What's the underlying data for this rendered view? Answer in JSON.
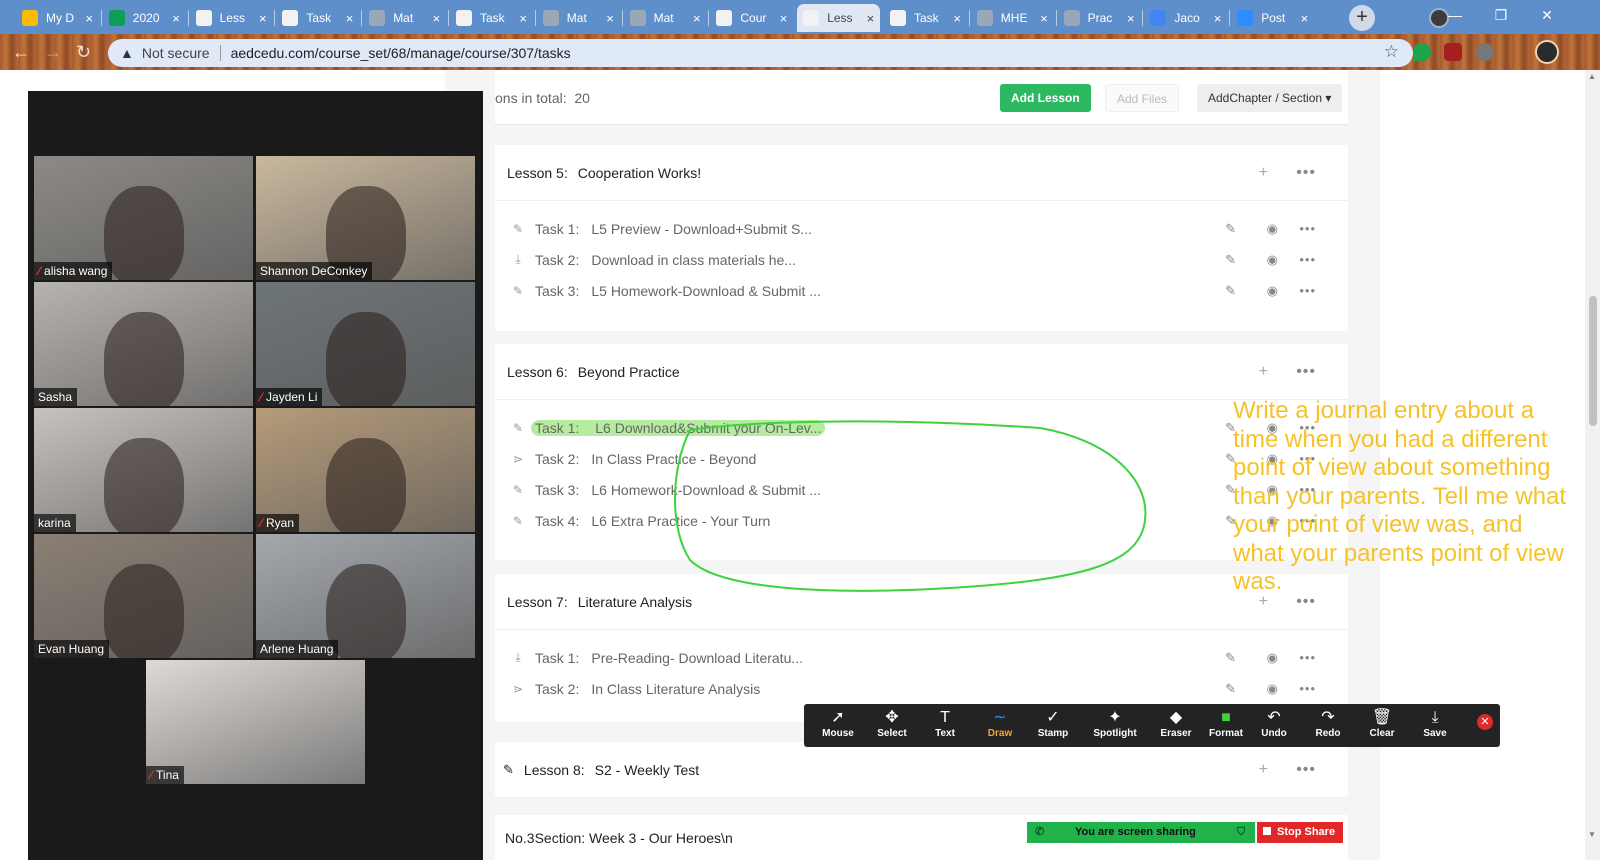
{
  "browser": {
    "tabs": [
      {
        "label": "My D",
        "favicon_color": "#fbbc05",
        "active": false
      },
      {
        "label": "2020",
        "favicon_color": "#0f9d58",
        "active": false
      },
      {
        "label": "Less",
        "favicon_color": "#f2f2f2",
        "active": false
      },
      {
        "label": "Task",
        "favicon_color": "#f2f2f2",
        "active": false
      },
      {
        "label": "Mat",
        "favicon_color": "#9aa7b8",
        "active": false
      },
      {
        "label": "Task",
        "favicon_color": "#f2f2f2",
        "active": false
      },
      {
        "label": "Mat",
        "favicon_color": "#9aa7b8",
        "active": false
      },
      {
        "label": "Mat",
        "favicon_color": "#9aa7b8",
        "active": false
      },
      {
        "label": "Cour",
        "favicon_color": "#f2f2f2",
        "active": false
      },
      {
        "label": "Less",
        "favicon_color": "#f2f2f2",
        "active": true
      },
      {
        "label": "Task",
        "favicon_color": "#f2f2f2",
        "active": false
      },
      {
        "label": "MHE",
        "favicon_color": "#9aa7b8",
        "active": false
      },
      {
        "label": "Prac",
        "favicon_color": "#9aa7b8",
        "active": false
      },
      {
        "label": "Jaco",
        "favicon_color": "#4285f4",
        "active": false
      },
      {
        "label": "Post",
        "favicon_color": "#2d8cff",
        "active": false
      }
    ],
    "tab_close": "×",
    "new_tab": "+",
    "address": {
      "security_label": "Not secure",
      "url": "aedcedu.com/course_set/68/manage/course/307/tasks"
    },
    "nav": {
      "back": "←",
      "forward": "→",
      "reload": "↻",
      "star": "☆"
    }
  },
  "page": {
    "lessons_total_label": "ons in total:",
    "lessons_total_value": "20",
    "buttons": {
      "add_lesson": "Add Lesson",
      "add_files": "Add Files",
      "add_chapter": "AddChapter / Section ▾"
    },
    "lessons": [
      {
        "num": "Lesson 5:",
        "title": "Cooperation Works!",
        "tasks": [
          {
            "icon": "✎",
            "num": "Task 1:",
            "title": "L5 Preview - Download+Submit S..."
          },
          {
            "icon": "⤓",
            "num": "Task 2:",
            "title": "Download in class materials he..."
          },
          {
            "icon": "✎",
            "num": "Task 3:",
            "title": "L5 Homework-Download & Submit ..."
          }
        ]
      },
      {
        "num": "Lesson 6:",
        "title": "Beyond Practice",
        "tasks": [
          {
            "icon": "✎",
            "num": "Task 1:",
            "title": "L6 Download&Submit your On-Lev..."
          },
          {
            "icon": "⋗",
            "num": "Task 2:",
            "title": "In Class Practice - Beyond"
          },
          {
            "icon": "✎",
            "num": "Task 3:",
            "title": "L6 Homework-Download & Submit ..."
          },
          {
            "icon": "✎",
            "num": "Task 4:",
            "title": "L6 Extra Practice - Your Turn"
          }
        ]
      },
      {
        "num": "Lesson 7:",
        "title": "Literature Analysis",
        "tasks": [
          {
            "icon": "⤓",
            "num": "Task 1:",
            "title": "Pre-Reading- Download Literatu..."
          },
          {
            "icon": "⋗",
            "num": "Task 2:",
            "title": "In Class Literature Analysis"
          }
        ]
      },
      {
        "num": "Lesson 8:",
        "title": "S2 - Weekly Test",
        "tasks": []
      }
    ],
    "section_footer": "No.3Section:  Week 3 - Our Heroes\\n",
    "row_actions": {
      "edit": "✎",
      "view": "◉",
      "more": "•••",
      "add": "+"
    }
  },
  "zoom": {
    "participants": [
      {
        "name": "alisha wang",
        "muted": true,
        "bg": "#8d8a86"
      },
      {
        "name": "Shannon DeConkey",
        "muted": false,
        "bg": "#c9b89d"
      },
      {
        "name": "Sasha",
        "muted": false,
        "bg": "#b8b3ae"
      },
      {
        "name": "Jayden Li",
        "muted": true,
        "bg": "#6e7578"
      },
      {
        "name": "karina",
        "muted": false,
        "bg": "#c7c2bd"
      },
      {
        "name": "Ryan",
        "muted": true,
        "bg": "#b59b7a"
      },
      {
        "name": "Evan Huang",
        "muted": false,
        "bg": "#8a7f74"
      },
      {
        "name": "Arlene Huang",
        "muted": false,
        "bg": "#a4a8ad"
      },
      {
        "name": "Tina",
        "muted": true,
        "bg": "#dedad6"
      }
    ],
    "muted_icon": "⁄",
    "annotation_text": "Write a journal entry about a time when you had a different point of view about something than your parents.  Tell me what your point of view was, and what your parents point of view was.",
    "annotation_color": "#f6c22a",
    "draw_color": "#3fd23f",
    "annotate_tools": [
      {
        "icon": "➚",
        "label": "Mouse"
      },
      {
        "icon": "✥",
        "label": "Select"
      },
      {
        "icon": "T",
        "label": "Text"
      },
      {
        "icon": "∼",
        "label": "Draw",
        "active": true
      },
      {
        "icon": "✓",
        "label": "Stamp"
      },
      {
        "icon": "✦",
        "label": "Spotlight"
      },
      {
        "icon": "◆",
        "label": "Eraser"
      },
      {
        "icon": "■",
        "label": "Format"
      },
      {
        "icon": "↶",
        "label": "Undo"
      },
      {
        "icon": "↷",
        "label": "Redo"
      },
      {
        "icon": "🗑",
        "label": "Clear"
      },
      {
        "icon": "⤓",
        "label": "Save"
      }
    ],
    "annotate_close": "✕",
    "share": {
      "status": "You are screen sharing",
      "stop": "Stop Share"
    }
  }
}
